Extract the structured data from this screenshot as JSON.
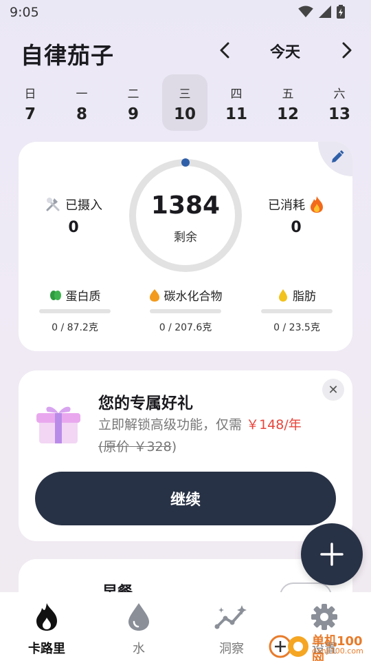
{
  "status_bar": {
    "time": "9:05"
  },
  "header": {
    "app_title": "自律茄子",
    "date_label": "今天"
  },
  "week": [
    {
      "name": "日",
      "num": "7"
    },
    {
      "name": "一",
      "num": "8"
    },
    {
      "name": "二",
      "num": "9"
    },
    {
      "name": "三",
      "num": "10",
      "selected": true
    },
    {
      "name": "四",
      "num": "11"
    },
    {
      "name": "五",
      "num": "12"
    },
    {
      "name": "六",
      "num": "13"
    }
  ],
  "summary": {
    "intake_label": "已摄入",
    "intake_value": "0",
    "remaining_value": "1384",
    "remaining_label": "剩余",
    "burned_label": "已消耗",
    "burned_value": "0",
    "macros": [
      {
        "name": "蛋白质",
        "value": "0 / 87.2克",
        "progress": 0,
        "color": "#2e9b3e"
      },
      {
        "name": "碳水化合物",
        "value": "0 / 207.6克",
        "progress": 0,
        "color": "#f29b1d"
      },
      {
        "name": "脂肪",
        "value": "0 / 23.5克",
        "progress": 0,
        "color": "#f2c21d"
      }
    ],
    "accent_color": "#2f5fa8"
  },
  "gift": {
    "title": "您的专属好礼",
    "subtitle": "立即解锁高级功能，仅需",
    "price": "￥148/年",
    "orig_prefix": "(原价",
    "orig_price": "￥328",
    "orig_suffix": ")",
    "continue_label": "继续",
    "close_glyph": "✕"
  },
  "meal": {
    "title": "早餐"
  },
  "tabs": [
    {
      "label": "卡路里",
      "icon": "flame-icon",
      "active": true
    },
    {
      "label": "水",
      "icon": "water-drop-icon"
    },
    {
      "label": "洞察",
      "icon": "insights-icon"
    },
    {
      "label": "设置",
      "icon": "gear-icon"
    }
  ],
  "watermark": {
    "text": "单机100网",
    "url": "danji100.com"
  }
}
